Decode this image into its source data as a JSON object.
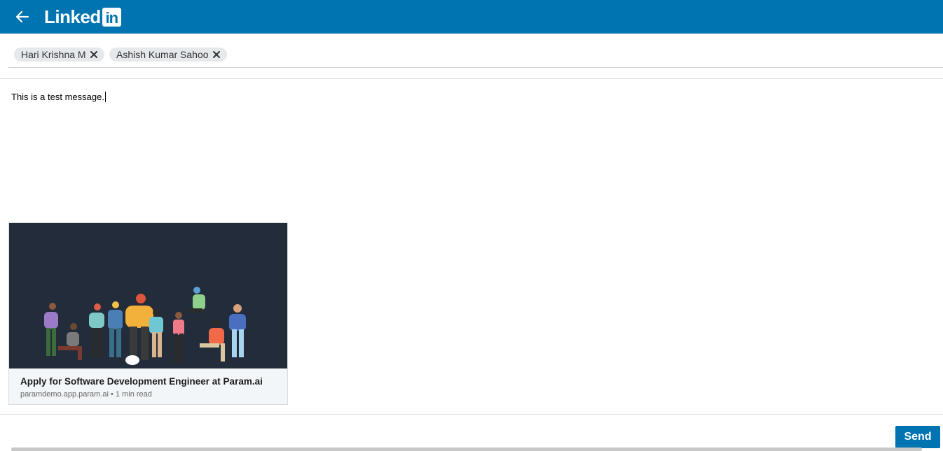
{
  "header": {
    "logo_text": "Linked",
    "logo_box": "in",
    "brand_color": "#0073b1"
  },
  "recipients": [
    {
      "name": "Hari Krishna M"
    },
    {
      "name": "Ashish Kumar Sahoo"
    }
  ],
  "compose": {
    "message": "This is a test message."
  },
  "preview_card": {
    "title": "Apply for Software Development Engineer at Param.ai",
    "meta": "paramdemo.app.param.ai • 1 min read"
  },
  "actions": {
    "send_label": "Send"
  }
}
